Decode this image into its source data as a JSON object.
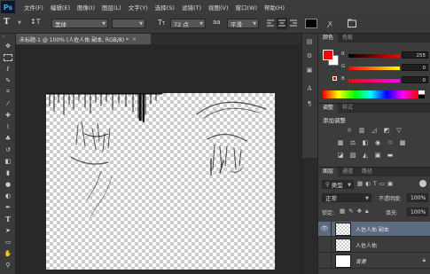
{
  "app": {
    "logo": "Ps"
  },
  "menu": [
    "文件(F)",
    "编辑(E)",
    "图像(I)",
    "图层(L)",
    "文字(Y)",
    "选择(S)",
    "滤镜(T)",
    "视图(V)",
    "窗口(W)",
    "帮助(H)"
  ],
  "options": {
    "font_family": "黑体",
    "font_size": "72 点",
    "antialias": "平滑",
    "text_color": "#000000"
  },
  "document": {
    "tab_title": "未标题-1 @ 100% (人佐人佑 副本, RGB/8) *"
  },
  "color_panel": {
    "tabs": [
      "颜色",
      "色板"
    ],
    "foreground": "#ff0000",
    "background": "#ffffff",
    "r_label": "R",
    "g_label": "G",
    "b_label": "B",
    "r_value": "255",
    "g_value": "0",
    "b_value": "0"
  },
  "adjust_panel": {
    "tabs": [
      "调整",
      "样式"
    ],
    "title": "添加调整"
  },
  "layers_panel": {
    "tabs": [
      "图层",
      "通道",
      "路径"
    ],
    "filter_kind": "类型",
    "blend_mode": "正常",
    "opacity_label": "不透明度:",
    "opacity_value": "100%",
    "lock_label": "锁定:",
    "fill_label": "填充:",
    "fill_value": "100%",
    "layers": [
      {
        "name": "人佐人佑 副本"
      },
      {
        "name": "人佐人佑"
      },
      {
        "name": "背景"
      }
    ]
  }
}
